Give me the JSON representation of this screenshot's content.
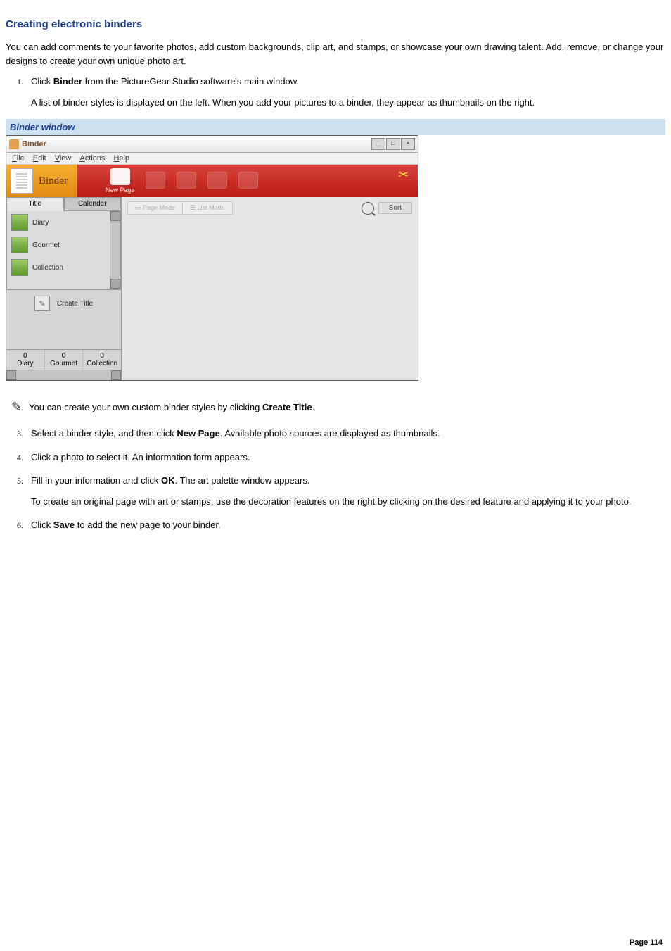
{
  "page": {
    "heading": "Creating electronic binders",
    "intro": "You can add comments to your favorite photos, add custom backgrounds, clip art, and stamps, or showcase your own drawing talent. Add, remove, or change your designs to create your own unique photo art.",
    "caption": "Binder window",
    "footer": "Page 114"
  },
  "steps": {
    "s1a": "Click ",
    "s1b": "Binder",
    "s1c": " from the PictureGear Studio    software's main window.",
    "s1extra": "A list of binder styles is displayed on the left. When you add your pictures to a binder, they appear as thumbnails on the right.",
    "tip_a": "You can create your own custom binder styles by clicking ",
    "tip_b": "Create Title",
    "tip_c": ".",
    "s2a": "Select a binder style, and then click ",
    "s2b": "New Page",
    "s2c": ". Available photo sources are displayed as thumbnails.",
    "s3": "Click a photo to select it. An information form appears.",
    "s4a": "Fill in your information and click ",
    "s4b": "OK",
    "s4c": ". The art palette window appears.",
    "s4extra": "To create an original page with art or stamps, use the decoration features on the right by clicking on the desired feature and applying it to your photo.",
    "s5a": "Click ",
    "s5b": "Save",
    "s5c": " to add the new page to your binder."
  },
  "app": {
    "title": "Binder",
    "menus": {
      "file": "File",
      "edit": "Edit",
      "view": "View",
      "actions": "Actions",
      "help": "Help"
    },
    "toolbar": {
      "brand": "Binder",
      "newpage": "New Page"
    },
    "tabs": {
      "title": "Title",
      "calender": "Calender"
    },
    "styles": {
      "diary": "Diary",
      "gourmet": "Gourmet",
      "collection": "Collection"
    },
    "create_title": "Create Title",
    "counts": {
      "diary": {
        "val": "0",
        "name": "Diary"
      },
      "gourmet": {
        "val": "0",
        "name": "Gourmet"
      },
      "collection": {
        "val": "0",
        "name": "Collection"
      }
    },
    "modes": {
      "page": "Page Mode",
      "list": "List Mode"
    },
    "sort": "Sort"
  }
}
